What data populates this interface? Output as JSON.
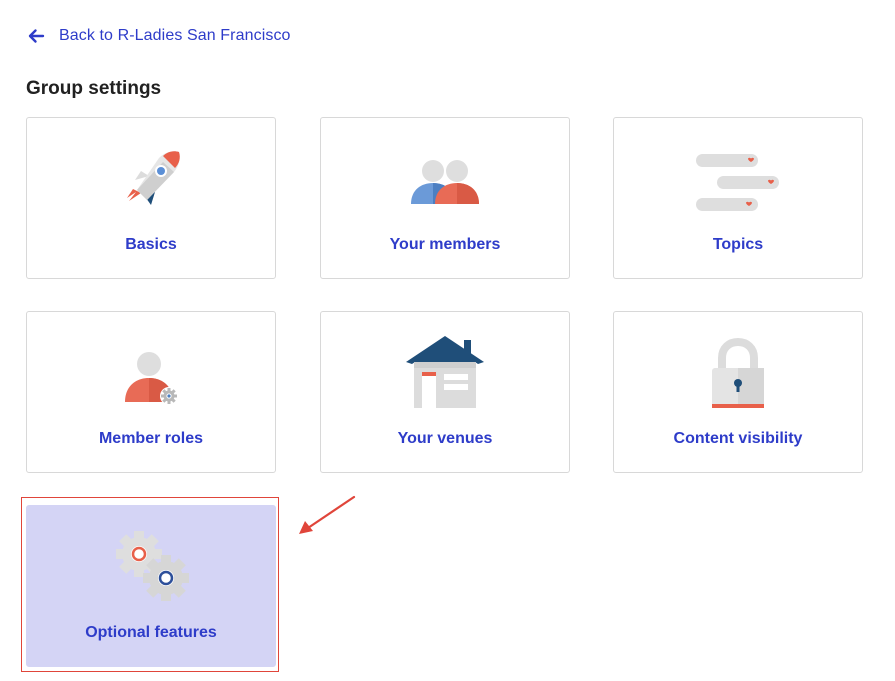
{
  "back_link": {
    "label": "Back to R-Ladies San Francisco",
    "icon": "arrow-left-icon"
  },
  "page_title": "Group settings",
  "cards": [
    {
      "label": "Basics",
      "icon": "rocket-icon"
    },
    {
      "label": "Your members",
      "icon": "members-icon"
    },
    {
      "label": "Topics",
      "icon": "topics-icon"
    },
    {
      "label": "Member roles",
      "icon": "member-roles-icon"
    },
    {
      "label": "Your venues",
      "icon": "house-icon"
    },
    {
      "label": "Content visibility",
      "icon": "padlock-icon"
    },
    {
      "label": "Optional features",
      "icon": "gears-icon",
      "selected": true
    }
  ],
  "colors": {
    "link_blue": "#2e3cc9",
    "selected_bg": "#d4d4f5",
    "highlight_red": "#e0453a"
  }
}
